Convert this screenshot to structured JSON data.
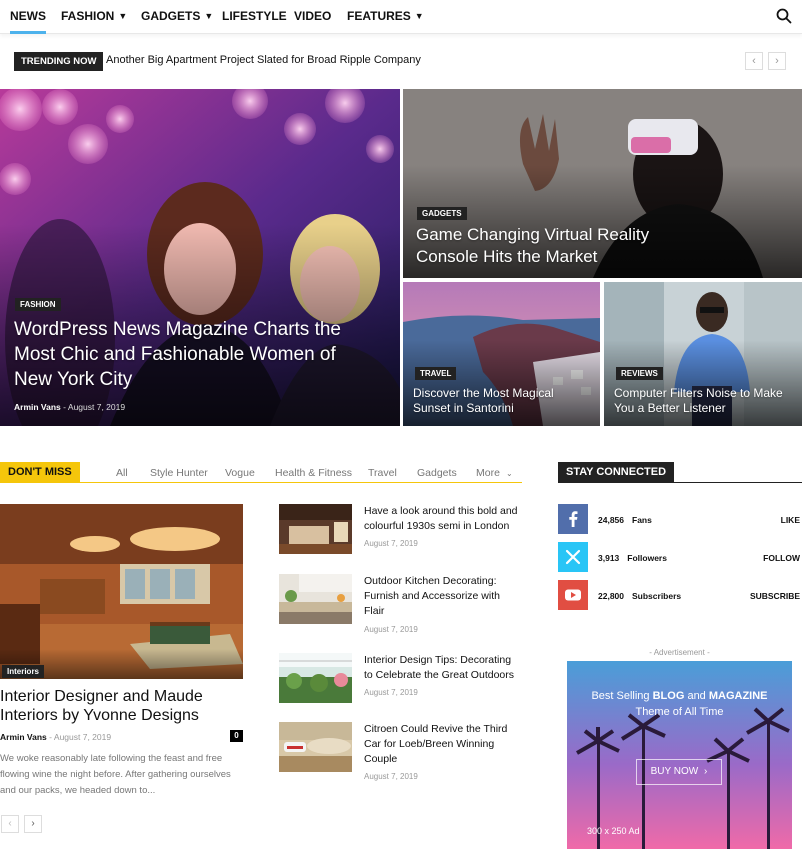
{
  "nav": {
    "items": [
      {
        "label": "NEWS"
      },
      {
        "label": "FASHION"
      },
      {
        "label": "GADGETS"
      },
      {
        "label": "LIFESTYLE"
      },
      {
        "label": "VIDEO"
      },
      {
        "label": "FEATURES"
      }
    ],
    "accent_color": "#4db2ec"
  },
  "trending": {
    "label": "TRENDING NOW",
    "headline": "Another Big Apartment Project Slated for Broad Ripple Company",
    "prev_icon": "‹",
    "next_icon": "›"
  },
  "hero": {
    "main": {
      "category": "FASHION",
      "title": "WordPress News Magazine Charts the Most Chic and Fashionable Women of New York City",
      "author": "Armin Vans",
      "separator": "-",
      "date": "August 7, 2019"
    },
    "top_right": {
      "category": "GADGETS",
      "title": "Game Changing Virtual Reality Console Hits the Market"
    },
    "bottom_left": {
      "category": "TRAVEL",
      "title": "Discover the Most Magical Sunset in Santorini"
    },
    "bottom_right": {
      "category": "REVIEWS",
      "title": "Computer Filters Noise to Make You a Better Listener"
    }
  },
  "dont_miss": {
    "label": "DON'T MISS",
    "accent_color": "#f5c60b",
    "filters": [
      "All",
      "Style Hunter",
      "Vogue",
      "Health & Fitness",
      "Travel",
      "Gadgets",
      "More"
    ],
    "main_post": {
      "category": "Interiors",
      "title": "Interior Designer and Maude Interiors by Yvonne Designs",
      "author": "Armin Vans",
      "separator": "-",
      "date": "August 7, 2019",
      "comments": "0",
      "excerpt": "We woke reasonably late following the feast and free flowing wine the night before. After gathering ourselves and our packs, we headed down to..."
    },
    "side_posts": [
      {
        "title": "Have a look around this bold and colourful 1930s semi in London",
        "date": "August 7, 2019"
      },
      {
        "title": "Outdoor Kitchen Decorating: Furnish and Accessorize with Flair",
        "date": "August 7, 2019"
      },
      {
        "title": "Interior Design Tips: Decorating to Celebrate the Great Outdoors",
        "date": "August 7, 2019"
      },
      {
        "title": "Citroen Could Revive the Third Car for Loeb/Breen Winning Couple",
        "date": "August 7, 2019"
      }
    ],
    "prev_icon": "‹",
    "next_icon": "›"
  },
  "stay_connected": {
    "label": "STAY CONNECTED",
    "networks": [
      {
        "icon": "facebook-icon",
        "count": "24,856",
        "unit": "Fans",
        "action": "LIKE",
        "color": "#516eab"
      },
      {
        "icon": "x-twitter-icon",
        "count": "3,913",
        "unit": "Followers",
        "action": "FOLLOW",
        "color": "#29c5f6"
      },
      {
        "icon": "youtube-icon",
        "count": "22,800",
        "unit": "Subscribers",
        "action": "SUBSCRIBE",
        "color": "#e14e42"
      }
    ]
  },
  "advertisement": {
    "label": "- Advertisement -",
    "line1_pre": "Best Selling ",
    "line1_b1": "BLOG",
    "line1_mid": " and ",
    "line1_b2": "MAGAZINE",
    "line2": "Theme of All Time",
    "button": "BUY NOW",
    "button_icon": "›",
    "size": "300 x 250 Ad"
  }
}
